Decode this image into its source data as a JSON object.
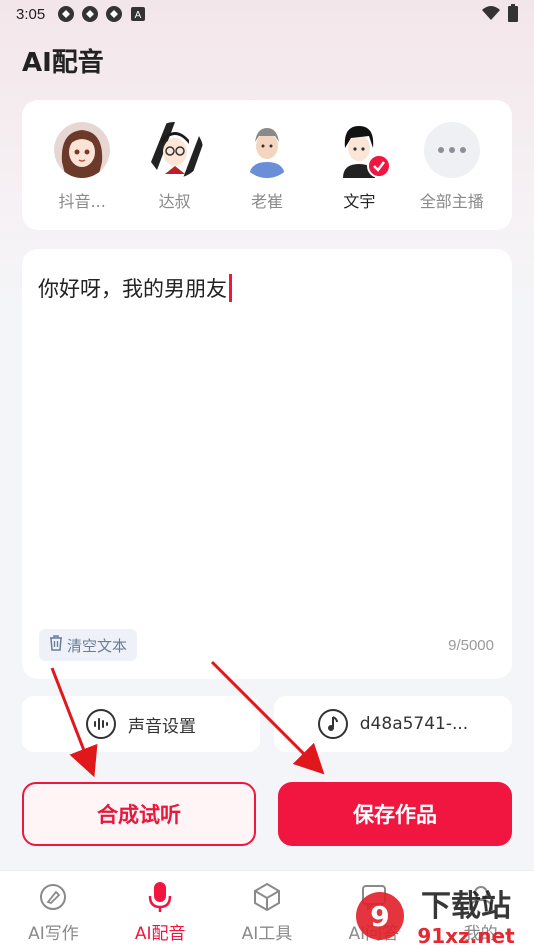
{
  "status_bar": {
    "time": "3:05"
  },
  "header": {
    "title": "AI配音"
  },
  "voices": [
    {
      "name": "抖音...",
      "selected": false
    },
    {
      "name": "达叔",
      "selected": false
    },
    {
      "name": "老崔",
      "selected": false
    },
    {
      "name": "文宇",
      "selected": true
    },
    {
      "name": "全部主播",
      "selected": false
    }
  ],
  "editor": {
    "text": "你好呀，我的男朋友",
    "clear_label": "清空文本",
    "char_count": "9/5000"
  },
  "settings": {
    "voice_setting_label": "声音设置",
    "music_label": "d48a5741-..."
  },
  "actions": {
    "preview_label": "合成试听",
    "save_label": "保存作品"
  },
  "nav": [
    {
      "label": "AI写作",
      "active": false
    },
    {
      "label": "AI配音",
      "active": true
    },
    {
      "label": "AI工具",
      "active": false
    },
    {
      "label": "AI问答",
      "active": false
    },
    {
      "label": "我的",
      "active": false
    }
  ],
  "watermark": {
    "text": "下载站",
    "url_text": "91xz.net"
  },
  "colors": {
    "accent": "#f0163f",
    "background": "#f4f5f8"
  }
}
